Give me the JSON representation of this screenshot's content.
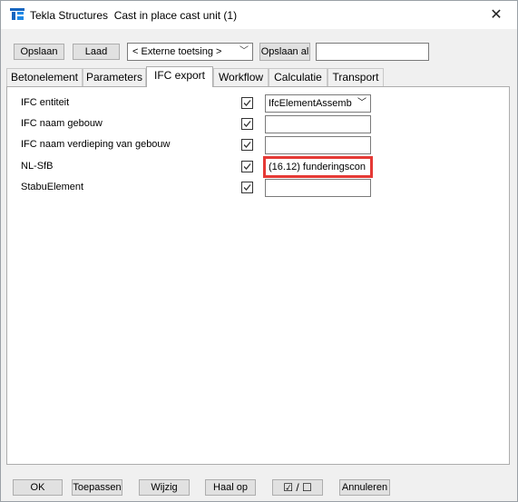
{
  "window": {
    "app": "Tekla Structures",
    "title": "Tekla Structures  Cast in place cast unit (1)",
    "close": "✕"
  },
  "toolbar": {
    "save_label": "Opslaan",
    "load_label": "Laad",
    "attribute_set": "< Externe toetsing >",
    "save_as_label": "Opslaan al",
    "save_as_name": ""
  },
  "tabs": [
    {
      "label": "Betonelement",
      "active": false
    },
    {
      "label": "Parameters",
      "active": false
    },
    {
      "label": "IFC export",
      "active": true
    },
    {
      "label": "Workflow",
      "active": false
    },
    {
      "label": "Calculatie",
      "active": false
    },
    {
      "label": "Transport",
      "active": false
    }
  ],
  "fields": [
    {
      "label": "IFC entiteit",
      "checked": true,
      "value": "IfcElementAssemb",
      "type": "select"
    },
    {
      "label": "IFC naam gebouw",
      "checked": true,
      "value": "",
      "type": "text"
    },
    {
      "label": "IFC naam verdieping van gebouw",
      "checked": true,
      "value": "",
      "type": "text"
    },
    {
      "label": "NL-SfB",
      "checked": true,
      "value": "(16.12) funderingscon",
      "type": "text",
      "highlighted": true
    },
    {
      "label": "StabuElement",
      "checked": true,
      "value": "",
      "type": "text"
    }
  ],
  "footer": {
    "ok_label": "OK",
    "apply_label": "Toepassen",
    "modify_label": "Wijzig",
    "get_label": "Haal op",
    "toggle_label": "☑ / ☐",
    "cancel_label": "Annuleren"
  },
  "colors": {
    "highlight": "#e53935",
    "active_tab": "#ffffff",
    "background": "#f0f0f0"
  }
}
